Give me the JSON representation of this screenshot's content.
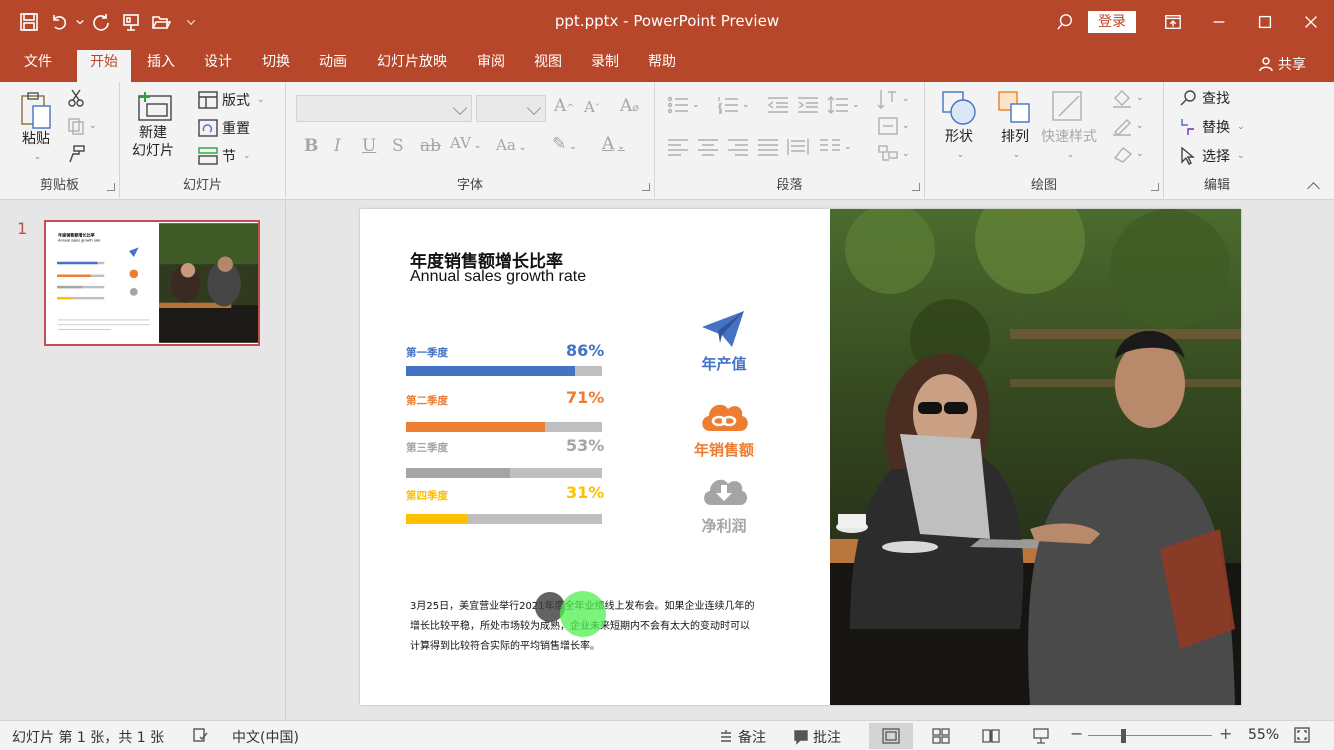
{
  "window": {
    "title": "ppt.pptx  -  PowerPoint Preview",
    "login_label": "登录",
    "share_label": "共享"
  },
  "tabs": [
    {
      "label": "文件"
    },
    {
      "label": "开始"
    },
    {
      "label": "插入"
    },
    {
      "label": "设计"
    },
    {
      "label": "切换"
    },
    {
      "label": "动画"
    },
    {
      "label": "幻灯片放映"
    },
    {
      "label": "审阅"
    },
    {
      "label": "视图"
    },
    {
      "label": "录制"
    },
    {
      "label": "帮助"
    }
  ],
  "active_tab": "开始",
  "ribbon": {
    "clipboard": {
      "label": "剪贴板",
      "paste": "粘贴"
    },
    "slides": {
      "label": "幻灯片",
      "new_slide_line1": "新建",
      "new_slide_line2": "幻灯片",
      "layout": "版式",
      "reset": "重置",
      "section": "节"
    },
    "font": {
      "label": "字体",
      "font_name": "",
      "font_size": ""
    },
    "paragraph": {
      "label": "段落"
    },
    "drawing": {
      "label": "绘图",
      "shapes": "形状",
      "arrange": "排列",
      "quick_styles": "快速样式"
    },
    "editing": {
      "label": "编辑",
      "find": "查找",
      "replace": "替换",
      "select": "选择"
    }
  },
  "thumbnails": [
    {
      "number": "1"
    }
  ],
  "slide": {
    "title_cn": "年度销售额增长比率",
    "title_en": "Annual sales growth rate",
    "quarters": [
      {
        "label": "第一季度",
        "percent": "86%",
        "value": 0.86,
        "color": "#4472c4"
      },
      {
        "label": "第二季度",
        "percent": "71%",
        "value": 0.71,
        "color": "#ed7d31"
      },
      {
        "label": "第三季度",
        "percent": "53%",
        "value": 0.53,
        "color": "#a5a5a5"
      },
      {
        "label": "第四季度",
        "percent": "31%",
        "value": 0.31,
        "color": "#ffc000"
      }
    ],
    "icons": [
      {
        "label": "年产值",
        "icon": "paper-plane-icon",
        "color": "#4472c4"
      },
      {
        "label": "年销售额",
        "icon": "cloud-link-icon",
        "color": "#ed7d31"
      },
      {
        "label": "净利润",
        "icon": "cloud-download-icon",
        "color": "#a5a5a5"
      }
    ],
    "paragraph_lines": [
      "3月25日，美宜营业举行2021年度全年业绩线上发布会。如果企业连续几年的",
      "增长比较平稳，所处市场较为成熟，企业未来短期内不会有太大的变动时可以",
      "计算得到比较符合实际的平均销售增长率。"
    ]
  },
  "thumbnail_text": {
    "title_cn": "年度销售额增长比率",
    "title_en": "Annual sales growth rate"
  },
  "status": {
    "slide_info": "幻灯片 第 1 张，共 1 张",
    "language": "中文(中国)",
    "notes": "备注",
    "comments": "批注",
    "zoom": "55%"
  },
  "colors": {
    "brand": "#b7472a",
    "accent_blue": "#4472c4",
    "accent_orange": "#ed7d31",
    "accent_gray": "#a5a5a5",
    "accent_yellow": "#ffc000"
  }
}
